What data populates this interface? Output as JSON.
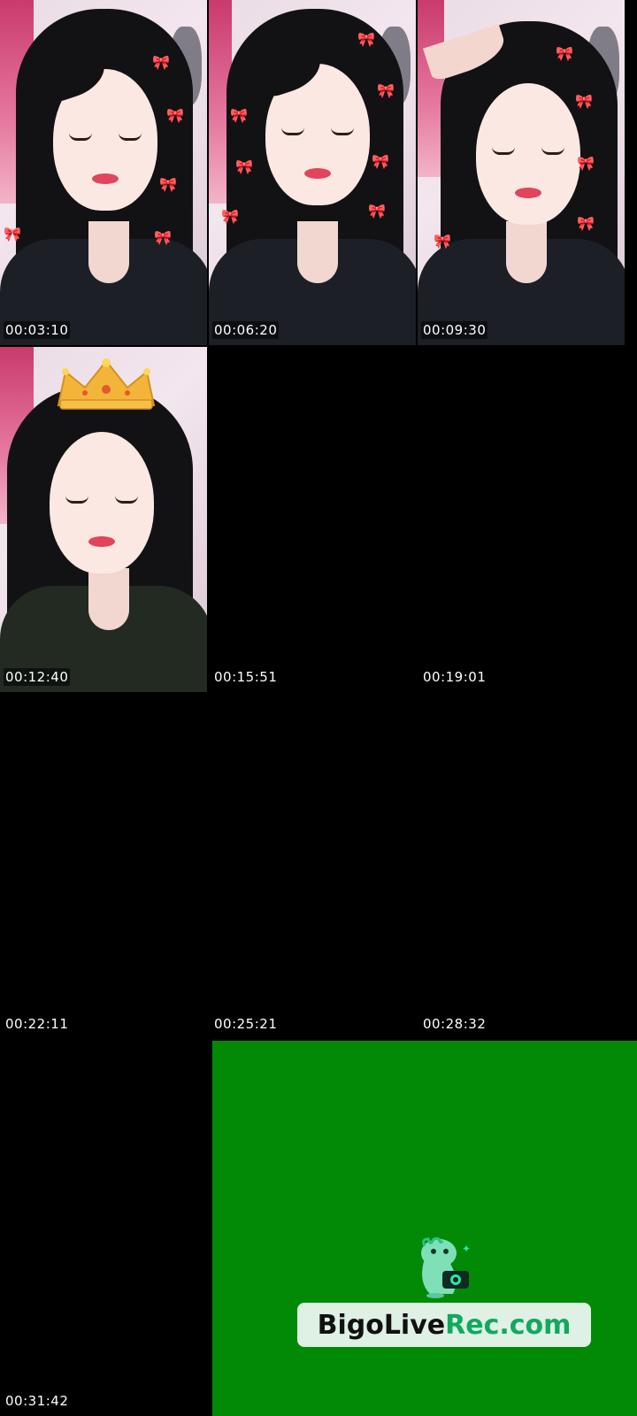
{
  "grid": {
    "thumbnails": [
      {
        "timestamp": "00:03:10",
        "state": "image",
        "effect": "bow-stickers"
      },
      {
        "timestamp": "00:06:20",
        "state": "image",
        "effect": "bow-stickers"
      },
      {
        "timestamp": "00:09:30",
        "state": "image",
        "effect": "bow-stickers"
      },
      {
        "timestamp": "00:12:40",
        "state": "image",
        "effect": "crown-sticker"
      },
      {
        "timestamp": "00:15:51",
        "state": "black"
      },
      {
        "timestamp": "00:19:01",
        "state": "black"
      },
      {
        "timestamp": "00:22:11",
        "state": "black"
      },
      {
        "timestamp": "00:25:21",
        "state": "black"
      },
      {
        "timestamp": "00:28:32",
        "state": "black"
      },
      {
        "timestamp": "00:31:42",
        "state": "black"
      }
    ],
    "end_card": {
      "brand_part1": "BigoLive",
      "brand_part2": "Rec.com",
      "background_color": "#028a07",
      "brand_part1_color": "#111111",
      "brand_part2_color": "#11a860",
      "mascot_icon": "dinosaur-camera-icon"
    }
  }
}
